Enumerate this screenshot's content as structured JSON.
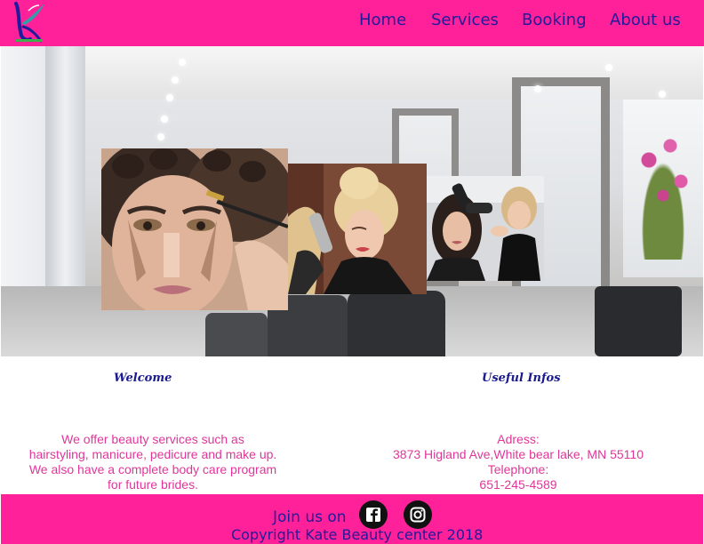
{
  "nav": {
    "items": [
      {
        "label": "Home"
      },
      {
        "label": "Services"
      },
      {
        "label": "Booking"
      },
      {
        "label": "About us"
      }
    ]
  },
  "welcome": {
    "title": "Welcome",
    "lines": [
      "We offer beauty services such as",
      "hairstyling, manicure, pedicure and make up.",
      "We also have a complete body care program",
      "for future brides."
    ]
  },
  "infos": {
    "title": "Useful Infos",
    "address_label": "Adress:",
    "address": "3873 Higland Ave,White bear lake, MN 55110",
    "telephone_label": "Telephone:",
    "telephone": "651-245-4589"
  },
  "footer": {
    "join_label": "Join us on",
    "copyright": "Copyright Kate Beauty center 2018"
  },
  "icons": {
    "logo": "feather-k-logo-icon",
    "facebook": "facebook-icon",
    "instagram": "instagram-icon"
  },
  "colors": {
    "brand_pink": "#fe2199",
    "nav_text": "#1f1b9a",
    "body_text": "#e0369a",
    "heading": "#1a1a8e"
  }
}
